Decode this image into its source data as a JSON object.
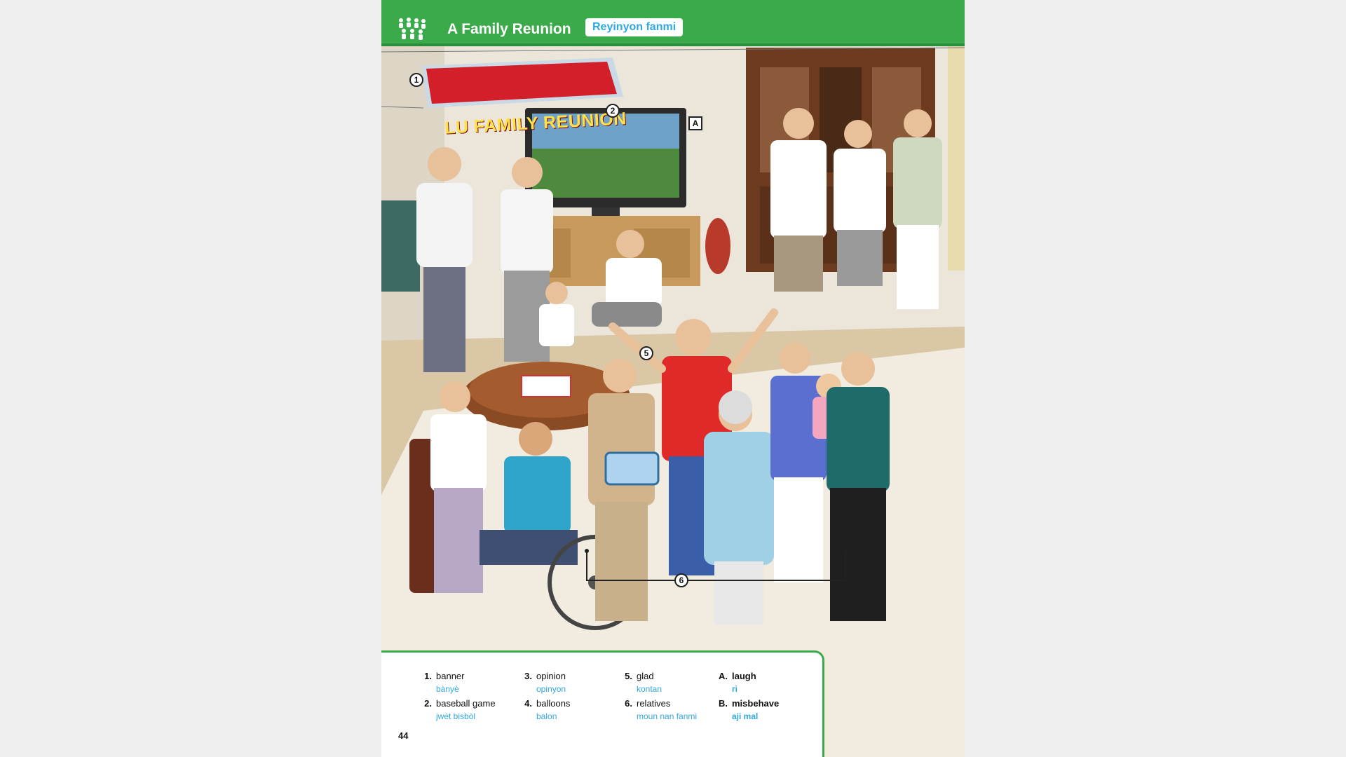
{
  "header": {
    "title": "A Family Reunion",
    "subtitle": "Reyinyon fanmi"
  },
  "illustration": {
    "banner_text": "LU FAMILY REUNION",
    "callouts": {
      "c1": "1",
      "c2": "2",
      "c5": "5",
      "c6": "6",
      "cA": "A"
    }
  },
  "vocabulary": [
    {
      "num": "1.",
      "word": "banner",
      "translation": "bànyè"
    },
    {
      "num": "2.",
      "word": "baseball game",
      "translation": "jwèt bisbòl"
    },
    {
      "num": "3.",
      "word": "opinion",
      "translation": "opinyon"
    },
    {
      "num": "4.",
      "word": "balloons",
      "translation": "balon"
    },
    {
      "num": "5.",
      "word": "glad",
      "translation": "kontan"
    },
    {
      "num": "6.",
      "word": "relatives",
      "translation": "moun nan fanmi"
    },
    {
      "num": "A.",
      "word": "laugh",
      "translation": "ri"
    },
    {
      "num": "B.",
      "word": "misbehave",
      "translation": "aji mal"
    }
  ],
  "page_number": "44",
  "colors": {
    "header_green": "#3aaa4a",
    "translation_blue": "#2fa8e0",
    "banner_red": "#d21f2a"
  }
}
